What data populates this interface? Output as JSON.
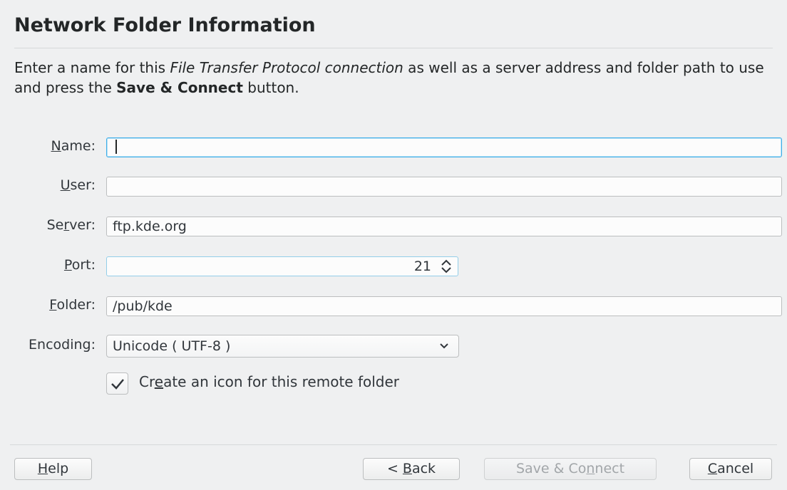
{
  "header": {
    "title": "Network Folder Information"
  },
  "description": {
    "part1": "Enter a name for this ",
    "italic": "File Transfer Protocol connection",
    "part2": " as well as a server address and folder path to use and press the ",
    "bold": "Save & Connect",
    "part3": " button."
  },
  "form": {
    "name": {
      "mnemonic": "N",
      "rest": "ame:",
      "value": ""
    },
    "user": {
      "mnemonic": "U",
      "rest": "ser:",
      "value": ""
    },
    "server": {
      "pre": "Se",
      "mnemonic": "r",
      "rest": "ver:",
      "value": "ftp.kde.org"
    },
    "port": {
      "mnemonic": "P",
      "rest": "ort:",
      "value": "21"
    },
    "folder": {
      "mnemonic": "F",
      "rest": "older:",
      "value": "/pub/kde"
    },
    "encoding": {
      "label": "Encoding:",
      "value": "Unicode ( UTF-8 )"
    },
    "create_icon": {
      "pre": "Cr",
      "mnemonic": "e",
      "rest": "ate an icon for this remote folder",
      "checked": true
    }
  },
  "buttons": {
    "help": {
      "mnemonic": "H",
      "rest": "elp"
    },
    "back": {
      "pre": "< ",
      "mnemonic": "B",
      "rest": "ack"
    },
    "save_connect": {
      "pre": "Save & Co",
      "mnemonic": "n",
      "rest": "nect",
      "enabled": false
    },
    "cancel": {
      "mnemonic": "C",
      "rest": "ancel"
    }
  },
  "icons": {
    "port_spinner": "updown-chevron-icon",
    "encoding_dropdown": "chevron-down-icon",
    "checkbox": "checkmark-icon"
  },
  "colors": {
    "background": "#eff0f1",
    "focus": "#3daee9",
    "text": "#31363b"
  }
}
